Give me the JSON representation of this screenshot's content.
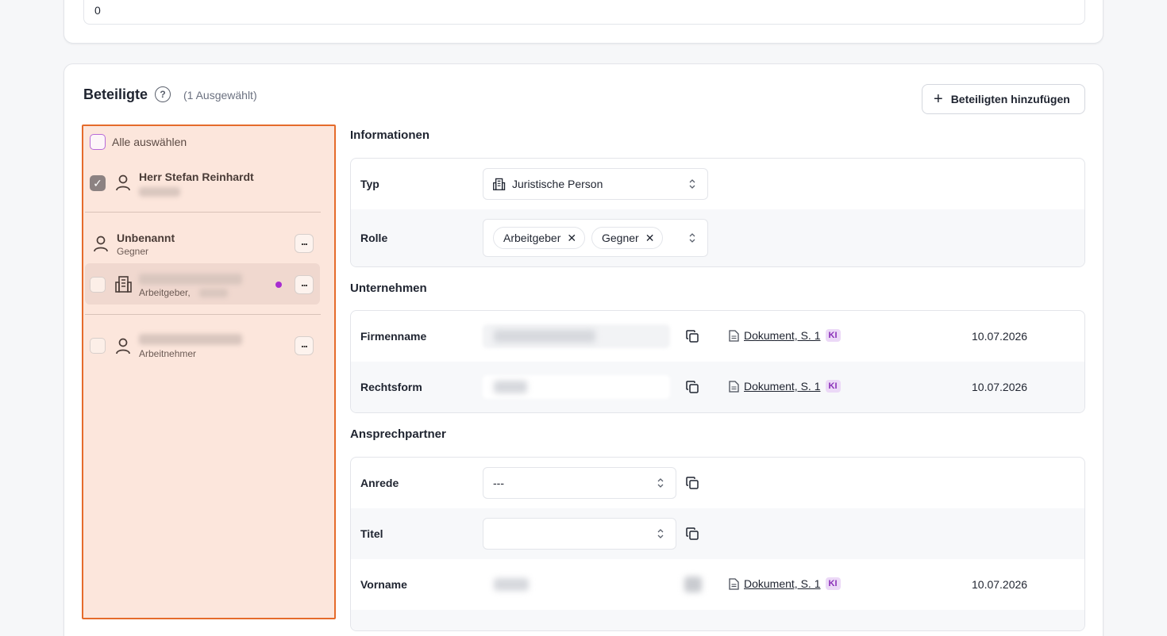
{
  "top_field": {
    "value": "0"
  },
  "header": {
    "title": "Beteiligte",
    "selected_count": "(1 Ausgewählt)",
    "add_button": "Beteiligten hinzufügen"
  },
  "participants": {
    "select_all": "Alle auswählen",
    "items": [
      {
        "name": "Herr Stefan Reinhardt",
        "sub": "",
        "checked": true
      },
      {
        "name": "Unbenannt",
        "sub": "Gegner",
        "checked": false
      },
      {
        "name": "",
        "sub": "Arbeitgeber,",
        "checked": false
      },
      {
        "name": "",
        "sub": "Arbeitnehmer",
        "checked": false
      }
    ]
  },
  "informationen": {
    "title": "Informationen",
    "typ_label": "Typ",
    "typ_value": "Juristische Person",
    "rolle_label": "Rolle",
    "rolle_chips": [
      "Arbeitgeber",
      "Gegner"
    ]
  },
  "unternehmen": {
    "title": "Unternehmen",
    "rows": [
      {
        "label": "Firmenname",
        "source": "Dokument, S. 1",
        "ki": "KI",
        "date": "10.07.2026"
      },
      {
        "label": "Rechtsform",
        "source": "Dokument, S. 1",
        "ki": "KI",
        "date": "10.07.2026"
      }
    ]
  },
  "ansprechpartner": {
    "title": "Ansprechpartner",
    "anrede_label": "Anrede",
    "anrede_value": "---",
    "titel_label": "Titel",
    "titel_value": "",
    "vorname_label": "Vorname",
    "vorname_source": "Dokument, S. 1",
    "vorname_ki": "KI",
    "vorname_date": "10.07.2026"
  }
}
